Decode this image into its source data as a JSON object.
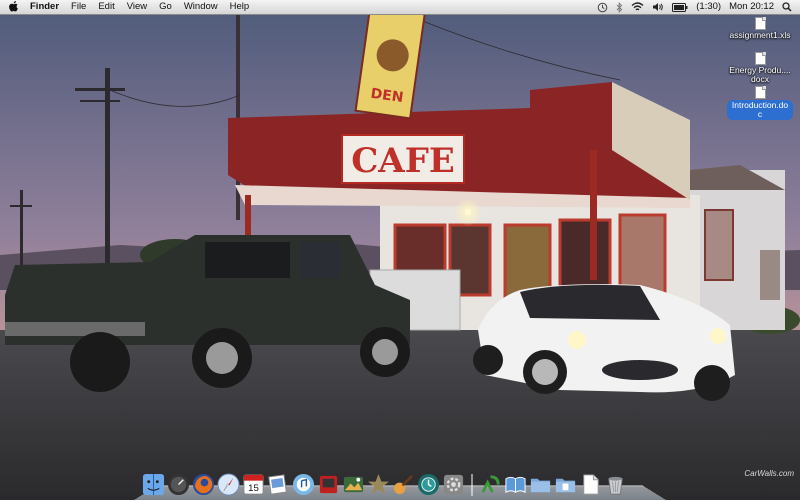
{
  "menubar": {
    "app_name": "Finder",
    "menus": [
      "File",
      "Edit",
      "View",
      "Go",
      "Window",
      "Help"
    ],
    "battery_text": "(1:30)",
    "clock": "Mon 20:12"
  },
  "desktop_icons": [
    {
      "label": "assignment1.xls",
      "selected": false
    },
    {
      "label": "Energy Produ....docx",
      "selected": false
    },
    {
      "label": "Introduction.doc",
      "selected": true
    }
  ],
  "wallpaper": {
    "sign_text": "CAFE",
    "upper_sign_text": "DEN",
    "watermark": "CarWalls.com"
  },
  "dock": {
    "items": [
      {
        "name": "finder-icon"
      },
      {
        "name": "dashboard-icon"
      },
      {
        "name": "firefox-icon"
      },
      {
        "name": "safari-icon"
      },
      {
        "name": "ical-icon",
        "text": "15"
      },
      {
        "name": "preview-icon"
      },
      {
        "name": "itunes-icon"
      },
      {
        "name": "photobooth-icon"
      },
      {
        "name": "iphoto-icon"
      },
      {
        "name": "imovie-icon"
      },
      {
        "name": "garageband-icon"
      },
      {
        "name": "timemachine-icon"
      },
      {
        "name": "system-preferences-icon"
      },
      {
        "name": "separator"
      },
      {
        "name": "app-store-icon"
      },
      {
        "name": "ibooks-icon"
      },
      {
        "name": "applications-folder-icon"
      },
      {
        "name": "documents-folder-icon"
      },
      {
        "name": "file-icon"
      },
      {
        "name": "trash-icon"
      }
    ]
  },
  "colors": {
    "menubar_bg": "#e6e6e6",
    "selection": "#2d6fd0",
    "sky_top": "#4e5a7a",
    "sky_bottom": "#d7a496",
    "cafe_red": "#8b2424"
  }
}
